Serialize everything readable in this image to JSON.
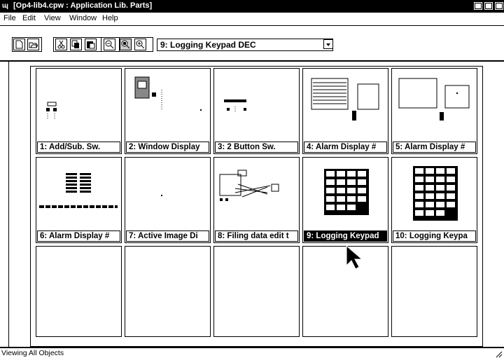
{
  "window": {
    "title": "[Op4-lib4.cpw : Application Lib. Parts]",
    "app_icon": "app-icon"
  },
  "menu": [
    "File",
    "Edit",
    "View",
    "Window",
    "Help"
  ],
  "menu_mnemonics": [
    "F",
    "E",
    "V",
    "W",
    "H"
  ],
  "toolbar": {
    "combo_value": "9: Logging Keypad DEC"
  },
  "items": [
    {
      "label": "1: Add/Sub. Sw."
    },
    {
      "label": "2: Window Display"
    },
    {
      "label": "3: 2 Button Sw."
    },
    {
      "label": "4: Alarm Display #"
    },
    {
      "label": "5: Alarm Display #"
    },
    {
      "label": "6: Alarm Display #"
    },
    {
      "label": "7: Active Image Di"
    },
    {
      "label": "8: Filing data edit t"
    },
    {
      "label": "9: Logging Keypad"
    },
    {
      "label": "10: Logging Keypa"
    }
  ],
  "status": {
    "text": "Viewing All Objects"
  }
}
